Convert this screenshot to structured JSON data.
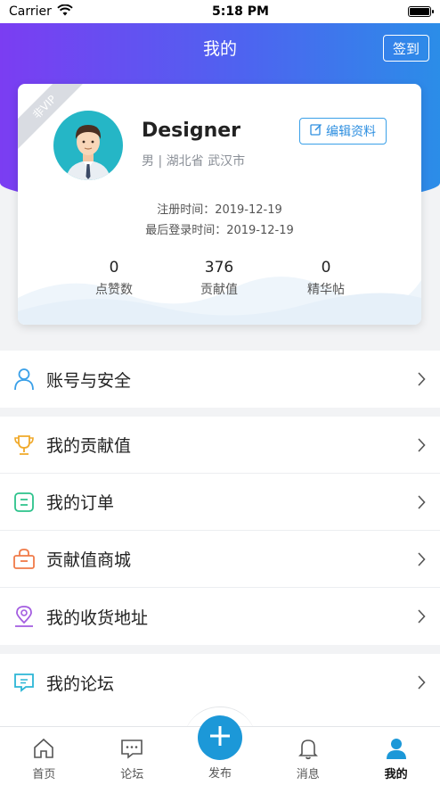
{
  "status_bar": {
    "carrier": "Carrier",
    "time": "5:18 PM"
  },
  "nav": {
    "title": "我的",
    "signin_label": "签到"
  },
  "profile": {
    "vip_badge": "非VIP",
    "name": "Designer",
    "info": "男 | 湖北省 武汉市",
    "edit_label": "编辑资料",
    "register_time": "注册时间：2019-12-19",
    "last_login_time": "最后登录时间：2019-12-19",
    "stats": [
      {
        "value": "0",
        "label": "点赞数"
      },
      {
        "value": "376",
        "label": "贡献值"
      },
      {
        "value": "0",
        "label": "精华帖"
      }
    ]
  },
  "menu": {
    "account": {
      "label": "账号与安全",
      "icon": "person-icon"
    },
    "group2": [
      {
        "label": "我的贡献值",
        "icon": "trophy-icon"
      },
      {
        "label": "我的订单",
        "icon": "order-icon"
      },
      {
        "label": "贡献值商城",
        "icon": "shop-icon"
      },
      {
        "label": "我的收货地址",
        "icon": "location-icon"
      }
    ],
    "forum": {
      "label": "我的论坛",
      "icon": "forum-icon"
    }
  },
  "tabbar": {
    "home": "首页",
    "forum": "论坛",
    "publish": "发布",
    "messages": "消息",
    "mine": "我的"
  },
  "colors": {
    "header_gradient_start": "#7b3df2",
    "header_gradient_end": "#2b8de8",
    "accent_blue": "#1c98d8"
  }
}
